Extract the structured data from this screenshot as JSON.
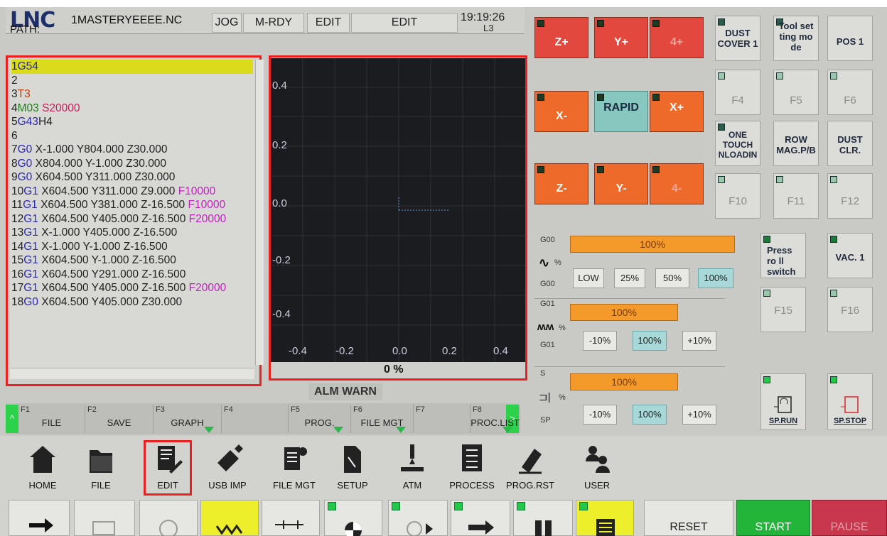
{
  "header": {
    "logo": "LNC",
    "filename": "1MASTERYEEEE.NC",
    "path_label": "PATH:",
    "mode": "JOG",
    "status": "M-RDY",
    "edit_label": "EDIT",
    "edit_mode": "EDIT",
    "time": "19:19:26",
    "line_label": "L3"
  },
  "code": {
    "lines": [
      {
        "n": "1",
        "parts": [
          {
            "t": "G54",
            "c": "g"
          }
        ],
        "hl": true
      },
      {
        "n": "2",
        "parts": []
      },
      {
        "n": "3",
        "parts": [
          {
            "t": "T3",
            "c": "t"
          }
        ]
      },
      {
        "n": "4",
        "parts": [
          {
            "t": "M03 ",
            "c": "gm"
          },
          {
            "t": "S20000",
            "c": "s"
          }
        ]
      },
      {
        "n": "5",
        "parts": [
          {
            "t": "G43",
            "c": "g"
          },
          {
            "t": "H4",
            "c": "ln"
          }
        ]
      },
      {
        "n": "6",
        "parts": []
      },
      {
        "n": "7",
        "parts": [
          {
            "t": "G0 ",
            "c": "g"
          },
          {
            "t": "X-1.000 Y804.000 Z30.000",
            "c": "ln"
          }
        ]
      },
      {
        "n": "8",
        "parts": [
          {
            "t": "G0 ",
            "c": "g"
          },
          {
            "t": "X804.000 Y-1.000 Z30.000",
            "c": "ln"
          }
        ]
      },
      {
        "n": "9",
        "parts": [
          {
            "t": "G0 ",
            "c": "g"
          },
          {
            "t": "X604.500 Y311.000 Z30.000",
            "c": "ln"
          }
        ]
      },
      {
        "n": "10",
        "parts": [
          {
            "t": "G1 ",
            "c": "g"
          },
          {
            "t": "X604.500 Y311.000 Z9.000 ",
            "c": "ln"
          },
          {
            "t": "F10000",
            "c": "f"
          }
        ]
      },
      {
        "n": "11",
        "parts": [
          {
            "t": "G1 ",
            "c": "g"
          },
          {
            "t": "X604.500 Y381.000 Z-16.500 ",
            "c": "ln"
          },
          {
            "t": "F10000",
            "c": "f"
          }
        ]
      },
      {
        "n": "12",
        "parts": [
          {
            "t": "G1 ",
            "c": "g"
          },
          {
            "t": "X604.500 Y405.000 Z-16.500 ",
            "c": "ln"
          },
          {
            "t": "F20000",
            "c": "f"
          }
        ]
      },
      {
        "n": "13",
        "parts": [
          {
            "t": "G1 ",
            "c": "g"
          },
          {
            "t": "X-1.000 Y405.000 Z-16.500",
            "c": "ln"
          }
        ]
      },
      {
        "n": "14",
        "parts": [
          {
            "t": "G1 ",
            "c": "g"
          },
          {
            "t": "X-1.000 Y-1.000 Z-16.500",
            "c": "ln"
          }
        ]
      },
      {
        "n": "15",
        "parts": [
          {
            "t": "G1 ",
            "c": "g"
          },
          {
            "t": "X604.500 Y-1.000 Z-16.500",
            "c": "ln"
          }
        ]
      },
      {
        "n": "16",
        "parts": [
          {
            "t": "G1 ",
            "c": "g"
          },
          {
            "t": "X604.500 Y291.000 Z-16.500",
            "c": "ln"
          }
        ]
      },
      {
        "n": "17",
        "parts": [
          {
            "t": "G1 ",
            "c": "g"
          },
          {
            "t": "X604.500 Y405.000 Z-16.500 ",
            "c": "ln"
          },
          {
            "t": "F20000",
            "c": "f"
          }
        ]
      },
      {
        "n": "18",
        "parts": [
          {
            "t": "G0 ",
            "c": "g"
          },
          {
            "t": "X604.500 Y405.000 Z30.000",
            "c": "ln"
          }
        ]
      }
    ]
  },
  "graph": {
    "y_ticks": [
      "0.4",
      "0.2",
      "0.0",
      "-0.2",
      "-0.4"
    ],
    "x_ticks": [
      "-0.4",
      "-0.2",
      "0.0",
      "0.2",
      "0.4"
    ],
    "percent": "0 %"
  },
  "alarms": {
    "label": "ALM WARN"
  },
  "fkeys": [
    {
      "num": "F1",
      "label": "FILE",
      "tri": false
    },
    {
      "num": "F2",
      "label": "SAVE",
      "tri": false
    },
    {
      "num": "F3",
      "label": "GRAPH",
      "tri": true
    },
    {
      "num": "F4",
      "label": "",
      "tri": false
    },
    {
      "num": "F5",
      "label": "PROG.",
      "tri": true
    },
    {
      "num": "F6",
      "label": "FILE MGT",
      "tri": true
    },
    {
      "num": "F7",
      "label": "",
      "tri": false
    },
    {
      "num": "F8",
      "label": "PROC.LIST",
      "tri": true
    }
  ],
  "fkey_nav": {
    "left": "^",
    "right": ">"
  },
  "menu": [
    {
      "label": "HOME",
      "icon": "home-icon"
    },
    {
      "label": "FILE",
      "icon": "folder-icon"
    },
    {
      "label": "EDIT",
      "icon": "edit-icon"
    },
    {
      "label": "USB IMP",
      "icon": "usb-icon"
    },
    {
      "label": "FILE MGT",
      "icon": "file-mgt-icon"
    },
    {
      "label": "SETUP",
      "icon": "setup-icon"
    },
    {
      "label": "ATM",
      "icon": "atm-icon"
    },
    {
      "label": "PROCESS",
      "icon": "process-icon"
    },
    {
      "label": "PROG.RST",
      "icon": "prog-rst-icon"
    },
    {
      "label": "USER",
      "icon": "user-icon"
    }
  ],
  "bottom_buttons": {
    "reset": "RESET",
    "start": "START",
    "pause": "PAUSE"
  },
  "jog": {
    "z_plus": "Z+",
    "y_plus": "Y+",
    "a_plus": "4+",
    "x_minus": "X-",
    "rapid": "RAPID",
    "x_plus": "X+",
    "z_minus": "Z-",
    "y_minus": "Y-",
    "a_minus": "4-"
  },
  "side_keys": {
    "dust_cover": "DUST COVER 1",
    "tool_set": "Tool set ting mo de",
    "pos1": "POS 1",
    "f4": "F4",
    "f5": "F5",
    "f6": "F6",
    "one_touch": "ONE TOUCH NLOADIN",
    "row_mag": "ROW MAG.P/B",
    "dust_clr": "DUST CLR.",
    "f10": "F10",
    "f11": "F11",
    "f12": "F12",
    "press_roll": "Press ro ll switch",
    "vac1": "VAC. 1",
    "f15": "F15",
    "f16": "F16",
    "sp_run": "SP.RUN",
    "sp_stop": "SP.STOP"
  },
  "overrides": {
    "g00": {
      "label": "G00",
      "sub": "G00",
      "pct_sign": "%",
      "value_text": "100%",
      "value": 100,
      "buttons": [
        "LOW",
        "25%",
        "50%",
        "100%"
      ],
      "selected": 3
    },
    "g01": {
      "label": "G01",
      "sub": "G01",
      "pct_sign": "%",
      "value_text": "100%",
      "value": 100,
      "buttons": [
        "-10%",
        "100%",
        "+10%"
      ],
      "selected": 1
    },
    "s": {
      "label": "S",
      "sub": "SP",
      "pct_sign": "%",
      "value_text": "100%",
      "value": 100,
      "buttons": [
        "-10%",
        "100%",
        "+10%"
      ],
      "selected": 1
    }
  },
  "colors": {
    "jog_red": "#e2483e",
    "jog_orange": "#ee6a2a",
    "rapid": "#86c7bf",
    "orange_bar": "#f39a2a",
    "green": "#23b53a",
    "pause": "#c8374c"
  }
}
